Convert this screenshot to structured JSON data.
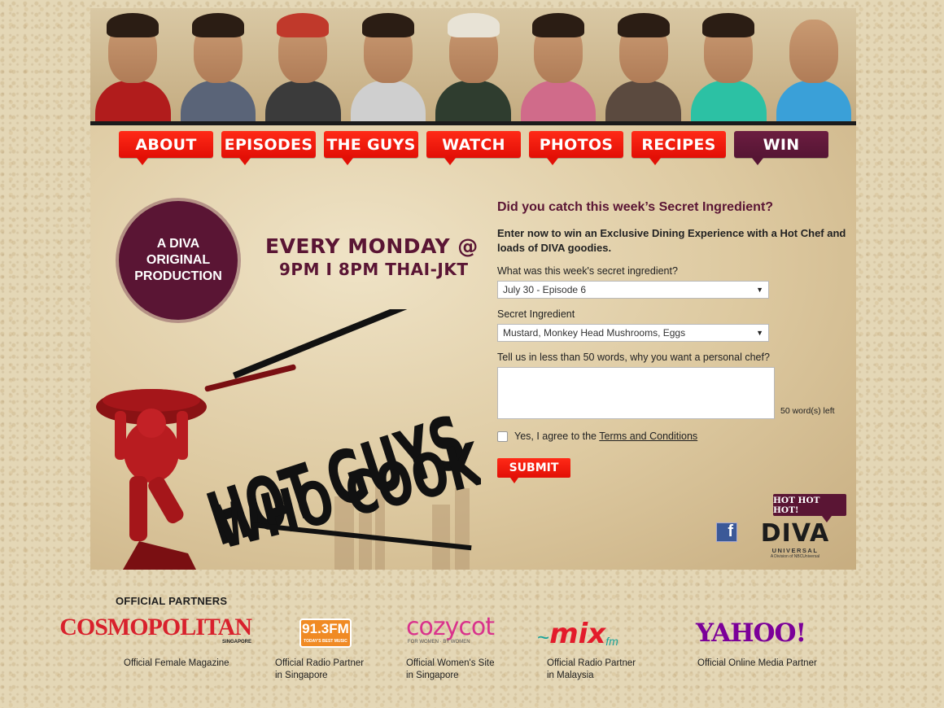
{
  "nav": [
    {
      "label": "ABOUT",
      "active": false
    },
    {
      "label": "EPISODES",
      "active": false
    },
    {
      "label": "THE GUYS",
      "active": false
    },
    {
      "label": "WATCH",
      "active": false
    },
    {
      "label": "PHOTOS",
      "active": false
    },
    {
      "label": "RECIPES",
      "active": false
    },
    {
      "label": "WIN",
      "active": true
    }
  ],
  "header": {
    "shirt_colors": [
      "#b11c1c",
      "#5a6478",
      "#3b3b3b",
      "#cfcfcf",
      "#2f3d2f",
      "#d06b8a",
      "#5b4a3f",
      "#2cc1a4",
      "#3aa0d8"
    ]
  },
  "badge": {
    "line1": "A DIVA",
    "line2": "ORIGINAL",
    "line3": "PRODUCTION"
  },
  "schedule": {
    "day": "EVERY MONDAY @",
    "time": "9PM I 8PM THAI-JKT"
  },
  "logo_text": {
    "line1": "HOT GUYS",
    "line2": "WHO COOK"
  },
  "form": {
    "title": "Did you catch this week’s Secret Ingredient?",
    "intro": "Enter now to win an Exclusive Dining Experience with a Hot Chef and loads of DIVA goodies.",
    "q1_label": "What was this week's secret ingredient?",
    "q1_value": "July 30 - Episode 6",
    "q2_label": "Secret Ingredient",
    "q2_value": "Mustard, Monkey Head Mushrooms, Eggs",
    "q3_label": "Tell us in less than 50 words, why you want a personal chef?",
    "q3_value": "",
    "word_count": "50 word(s) left",
    "agree_prefix": "Yes, I agree to the",
    "terms_link": "Terms and Conditions",
    "submit_label": "SUBMIT"
  },
  "brand": {
    "hot_tag": "HOT HOT HOT!",
    "facebook_icon": "f",
    "diva": "DIVA",
    "diva_sub": "UNIVERSAL",
    "diva_sub2": "A Division of NBCUniversal",
    "colors": {
      "accent_red": "#e20f06",
      "diva_plum": "#5a1534"
    }
  },
  "partners": {
    "title": "OFFICIAL PARTNERS",
    "items": [
      {
        "logo": "COSMOPOLITAN",
        "logo_sub": "SINGAPORE",
        "caption_1": "Official Female Magazine",
        "caption_2": ""
      },
      {
        "logo": "91.3FM",
        "logo_sub": "TODAY'S BEST MUSIC",
        "caption_1": "Official Radio Partner",
        "caption_2": "in Singapore"
      },
      {
        "logo": "cozycot",
        "logo_sub": "FOR WOMEN · BY WOMEN",
        "caption_1": "Official Women's Site",
        "caption_2": "in Singapore"
      },
      {
        "logo": "mix",
        "logo_sub": "fm",
        "caption_1": "Official Radio Partner",
        "caption_2": "in Malaysia"
      },
      {
        "logo": "YAHOO!",
        "logo_sub": "",
        "caption_1": "Official Online Media Partner",
        "caption_2": ""
      }
    ]
  }
}
